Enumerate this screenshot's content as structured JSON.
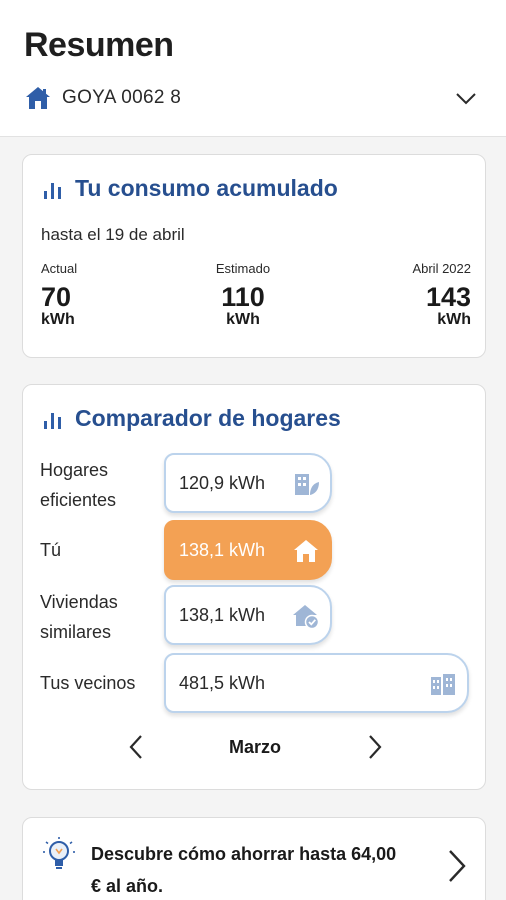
{
  "header": {
    "title": "Resumen",
    "address": "GOYA 0062 8"
  },
  "consumption": {
    "title": "Tu consumo acumulado",
    "subtitle": "hasta el 19 de abril",
    "stats": [
      {
        "label": "Actual",
        "value": "70",
        "unit": "kWh"
      },
      {
        "label": "Estimado",
        "value": "110",
        "unit": "kWh"
      },
      {
        "label": "Abril 2022",
        "value": "143",
        "unit": "kWh"
      }
    ]
  },
  "comparator": {
    "title": "Comparador de hogares",
    "rows": [
      {
        "label_line1": "Hogares",
        "label_line2": "eficientes",
        "value": "120,9 kWh",
        "icon": "efficient-building-icon"
      },
      {
        "label_line1": "Tú",
        "label_line2": "",
        "value": "138,1 kWh",
        "icon": "home-icon"
      },
      {
        "label_line1": "Viviendas",
        "label_line2": "similares",
        "value": "138,1 kWh",
        "icon": "home-check-icon"
      },
      {
        "label_line1": "Tus vecinos",
        "label_line2": "",
        "value": "481,5 kWh",
        "icon": "building-icon"
      }
    ],
    "month": "Marzo"
  },
  "tip": {
    "text_line1": "Descubre cómo ahorrar hasta 64,00",
    "text_line2": "€ al año."
  },
  "colors": {
    "accent_blue": "#274f8f",
    "icon_blue": "#2f5ea8",
    "orange": "#f3a154",
    "pill_border": "#bcd3ec"
  }
}
